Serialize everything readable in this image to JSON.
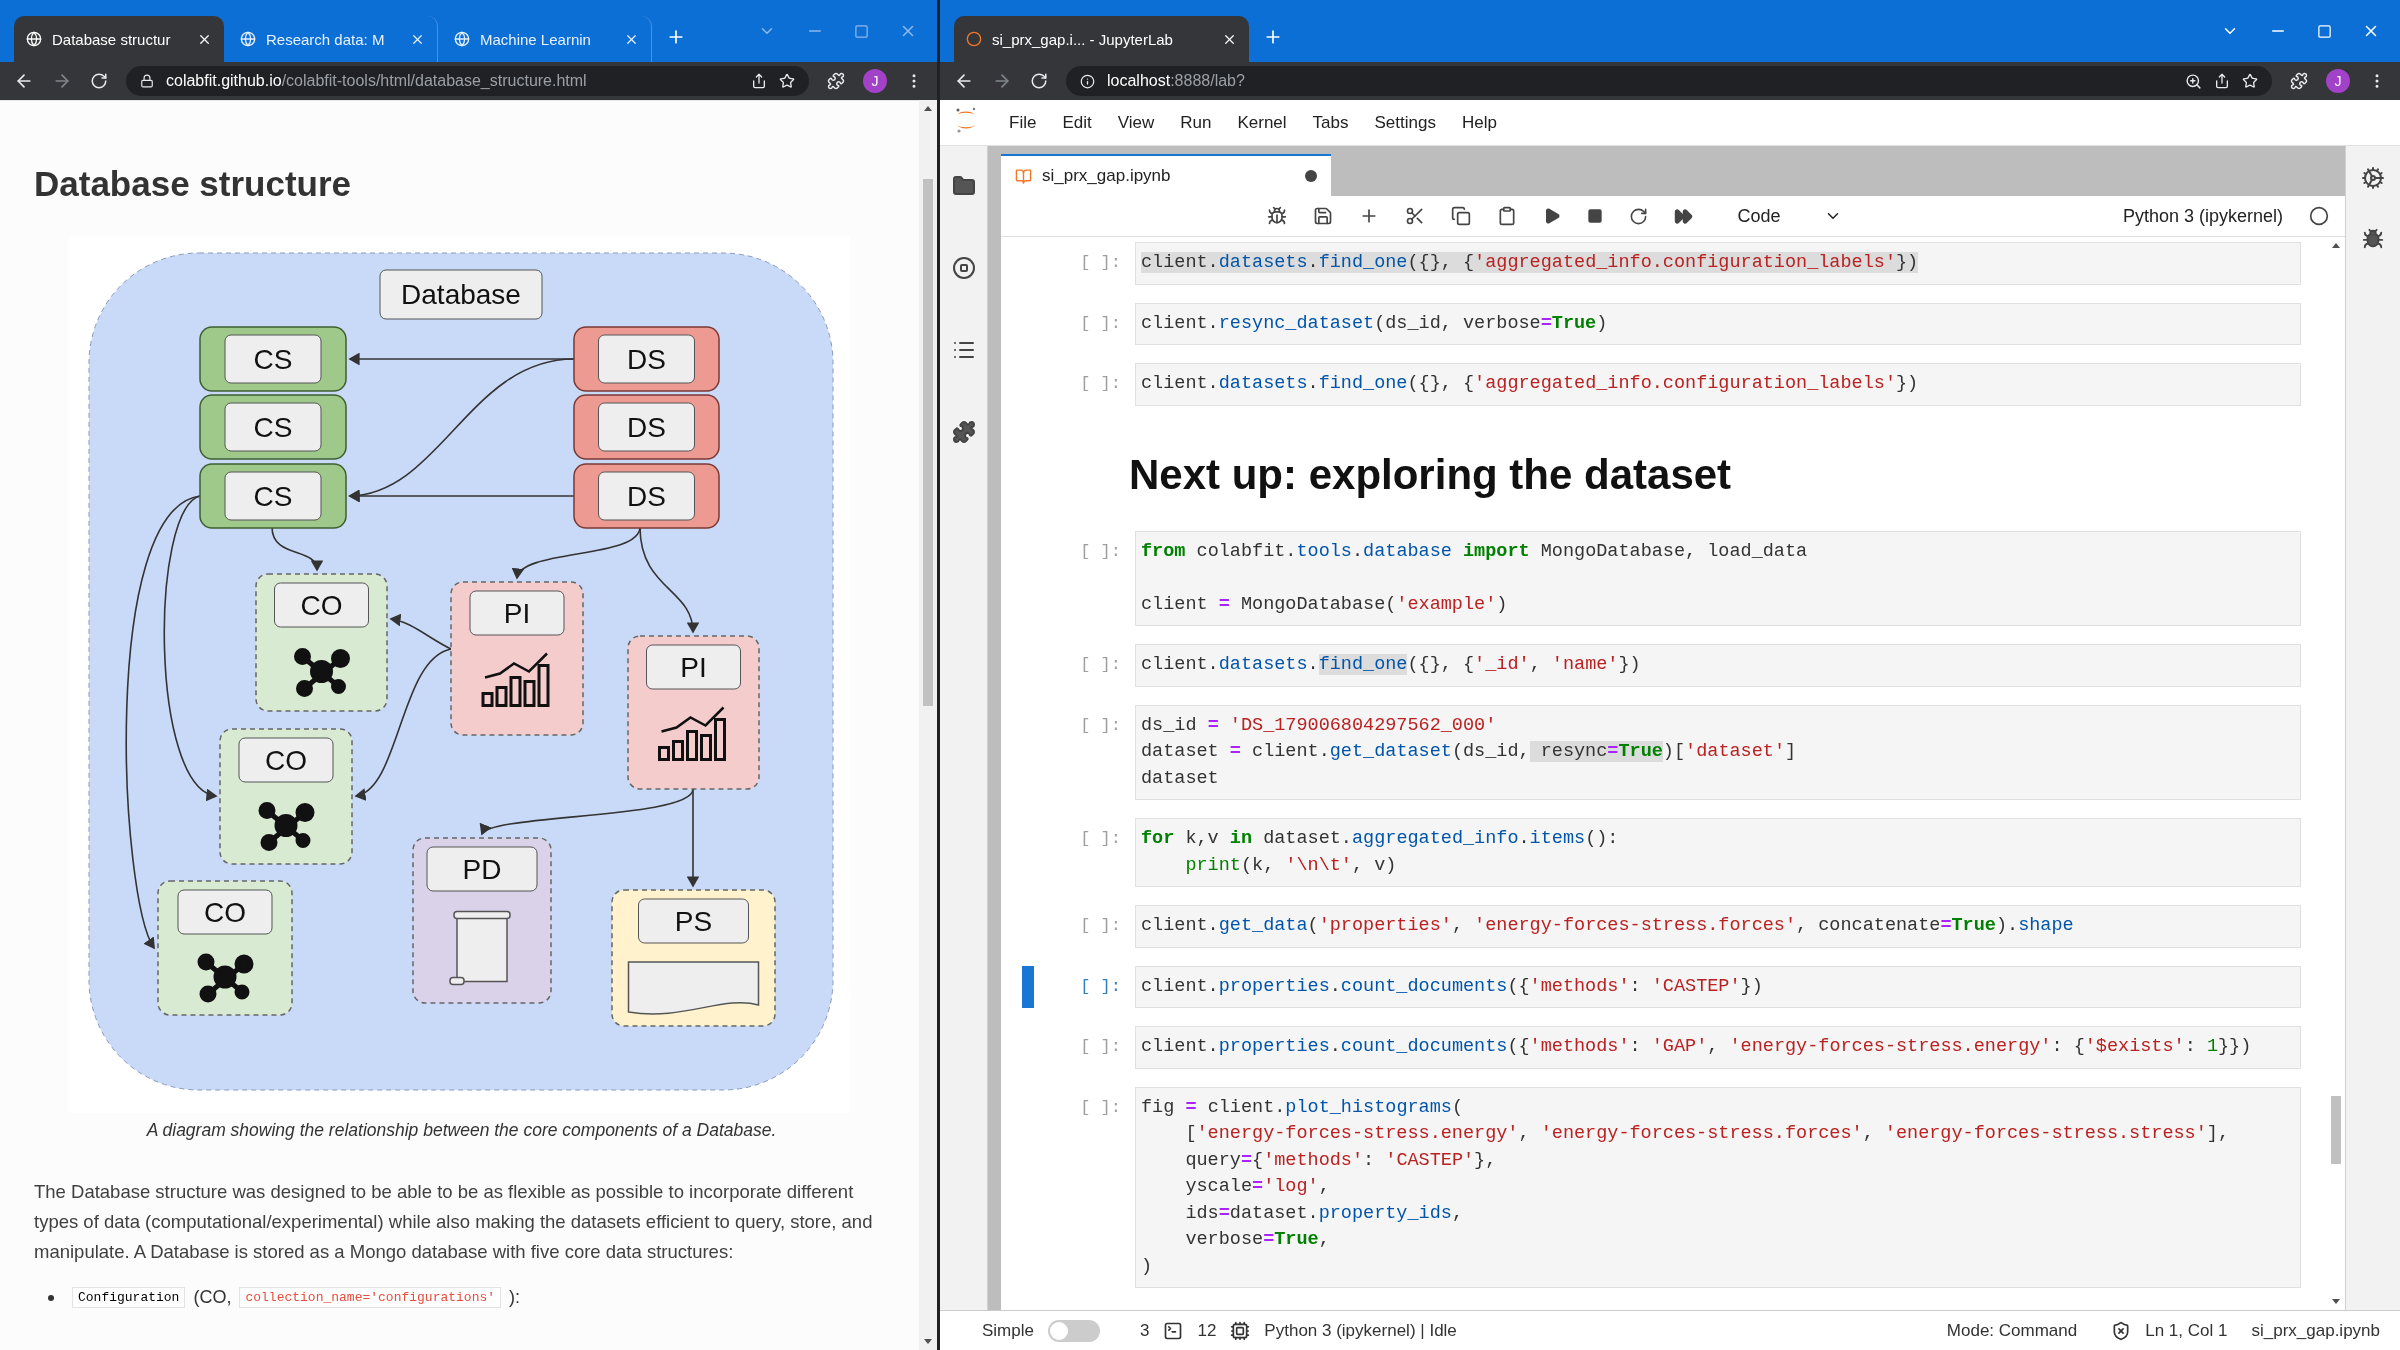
{
  "left_browser": {
    "tabs": [
      {
        "title": "Database structur",
        "selected": true
      },
      {
        "title": "Research data: M",
        "selected": false
      },
      {
        "title": "Machine Learnin",
        "selected": false
      }
    ],
    "address": {
      "host": "colabfit.github.io",
      "path": "/colabfit-tools/html/database_structure.html"
    },
    "profile": "J",
    "page": {
      "heading": "Database structure",
      "diagram": {
        "title": "Database",
        "nodes": [
          {
            "kind": "cs",
            "label": "CS"
          },
          {
            "kind": "cs",
            "label": "CS"
          },
          {
            "kind": "cs",
            "label": "CS"
          },
          {
            "kind": "ds",
            "label": "DS"
          },
          {
            "kind": "ds",
            "label": "DS"
          },
          {
            "kind": "ds",
            "label": "DS"
          },
          {
            "kind": "co",
            "label": "CO"
          },
          {
            "kind": "co",
            "label": "CO"
          },
          {
            "kind": "co",
            "label": "CO"
          },
          {
            "kind": "pi",
            "label": "PI"
          },
          {
            "kind": "pi",
            "label": "PI"
          },
          {
            "kind": "pd",
            "label": "PD"
          },
          {
            "kind": "ps",
            "label": "PS"
          }
        ]
      },
      "caption": "A diagram showing the relationship between the core components of a Database.",
      "paragraph": "The Database structure was designed to be able to be as flexible as possible to incorporate different types of data (computational/experimental) while also making the datasets efficient to query, store, and manipulate. A Database is stored as a Mongo database with five core data structures:",
      "bullet": {
        "code": "Configuration",
        "abbreviation": "(CO,",
        "collection": "collection_name='configurations'",
        "tail": "):"
      }
    }
  },
  "right_browser": {
    "tabs": [
      {
        "title": "si_prx_gap.i... - JupyterLab",
        "selected": true
      }
    ],
    "address": {
      "host": "localhost",
      "path": ":8888/lab?"
    },
    "profile": "J",
    "jupyter": {
      "menu": [
        "File",
        "Edit",
        "View",
        "Run",
        "Kernel",
        "Tabs",
        "Settings",
        "Help"
      ],
      "document_tab": {
        "title": "si_prx_gap.ipynb",
        "modified": true
      },
      "cell_type": "Code",
      "kernel": "Python 3 (ipykernel)",
      "cells": [
        {
          "kind": "code",
          "prompt": "[ ]:",
          "selected": false,
          "lines": [
            {
              "kind": "code",
              "highlighted": true,
              "segments": [
                {
                  "kind": "plain",
                  "text": "client."
                },
                {
                  "kind": "name",
                  "text": "datasets"
                },
                {
                  "kind": "plain",
                  "text": "."
                },
                {
                  "kind": "name",
                  "text": "find_one"
                },
                {
                  "kind": "plain",
                  "text": "({}, {"
                },
                {
                  "kind": "string",
                  "text": "'aggregated_info.configuration_labels'"
                },
                {
                  "kind": "plain",
                  "text": "})"
                }
              ]
            }
          ]
        },
        {
          "kind": "code",
          "prompt": "[ ]:",
          "selected": false,
          "lines": [
            {
              "kind": "code",
              "segments": [
                {
                  "kind": "plain",
                  "text": "client."
                },
                {
                  "kind": "name",
                  "text": "resync_dataset"
                },
                {
                  "kind": "plain",
                  "text": "(ds_id, verbose"
                },
                {
                  "kind": "operator",
                  "text": "="
                },
                {
                  "kind": "keyword",
                  "text": "True"
                },
                {
                  "kind": "plain",
                  "text": ")"
                }
              ]
            }
          ]
        },
        {
          "kind": "code",
          "prompt": "[ ]:",
          "selected": false,
          "lines": [
            {
              "kind": "code",
              "segments": [
                {
                  "kind": "plain",
                  "text": "client."
                },
                {
                  "kind": "name",
                  "text": "datasets"
                },
                {
                  "kind": "plain",
                  "text": "."
                },
                {
                  "kind": "name",
                  "text": "find_one"
                },
                {
                  "kind": "plain",
                  "text": "({}, {"
                },
                {
                  "kind": "string",
                  "text": "'aggregated_info.configuration_labels'"
                },
                {
                  "kind": "plain",
                  "text": "})"
                }
              ]
            }
          ]
        },
        {
          "kind": "markdown",
          "text": "Next up: exploring the dataset"
        },
        {
          "kind": "code",
          "prompt": "[ ]:",
          "selected": false,
          "lines": [
            {
              "kind": "code",
              "segments": [
                {
                  "kind": "keyword",
                  "text": "from"
                },
                {
                  "kind": "plain",
                  "text": " colabfit."
                },
                {
                  "kind": "name",
                  "text": "tools"
                },
                {
                  "kind": "plain",
                  "text": "."
                },
                {
                  "kind": "name",
                  "text": "database"
                },
                {
                  "kind": "keyword",
                  "text": " import"
                },
                {
                  "kind": "plain",
                  "text": " MongoDatabase, load_data"
                }
              ]
            },
            {
              "kind": "blank"
            },
            {
              "kind": "code",
              "segments": [
                {
                  "kind": "plain",
                  "text": "client "
                },
                {
                  "kind": "operator",
                  "text": "="
                },
                {
                  "kind": "plain",
                  "text": " MongoDatabase("
                },
                {
                  "kind": "string",
                  "text": "'example'"
                },
                {
                  "kind": "plain",
                  "text": ")"
                }
              ]
            }
          ]
        },
        {
          "kind": "code",
          "prompt": "[ ]:",
          "selected": false,
          "lines": [
            {
              "kind": "code",
              "segments": [
                {
                  "kind": "plain",
                  "text": "client."
                },
                {
                  "kind": "name",
                  "text": "datasets"
                },
                {
                  "kind": "plain",
                  "text": "."
                },
                {
                  "kind": "name",
                  "text": "find_one",
                  "highlighted": true
                },
                {
                  "kind": "plain",
                  "text": "({}, {"
                },
                {
                  "kind": "string",
                  "text": "'_id'"
                },
                {
                  "kind": "plain",
                  "text": ", "
                },
                {
                  "kind": "string",
                  "text": "'name'"
                },
                {
                  "kind": "plain",
                  "text": "})"
                }
              ]
            }
          ]
        },
        {
          "kind": "code",
          "prompt": "[ ]:",
          "selected": false,
          "lines": [
            {
              "kind": "code",
              "segments": [
                {
                  "kind": "plain",
                  "text": "ds_id "
                },
                {
                  "kind": "operator",
                  "text": "="
                },
                {
                  "kind": "string",
                  "text": " 'DS_179006804297562_000'"
                }
              ]
            },
            {
              "kind": "code",
              "segments": [
                {
                  "kind": "plain",
                  "text": "dataset "
                },
                {
                  "kind": "operator",
                  "text": "="
                },
                {
                  "kind": "plain",
                  "text": " client."
                },
                {
                  "kind": "name",
                  "text": "get_dataset"
                },
                {
                  "kind": "plain",
                  "text": "(ds_id,"
                },
                {
                  "kind": "plain",
                  "text": " resync",
                  "highlighted": true
                },
                {
                  "kind": "operator",
                  "text": "=",
                  "highlighted": true
                },
                {
                  "kind": "keyword",
                  "text": "True",
                  "highlighted": true
                },
                {
                  "kind": "plain",
                  "text": ")["
                },
                {
                  "kind": "string",
                  "text": "'dataset'"
                },
                {
                  "kind": "plain",
                  "text": "]"
                }
              ]
            },
            {
              "kind": "code",
              "segments": [
                {
                  "kind": "plain",
                  "text": "dataset"
                }
              ]
            }
          ]
        },
        {
          "kind": "code",
          "prompt": "[ ]:",
          "selected": false,
          "lines": [
            {
              "kind": "code",
              "segments": [
                {
                  "kind": "keyword",
                  "text": "for"
                },
                {
                  "kind": "plain",
                  "text": " k,v "
                },
                {
                  "kind": "keyword",
                  "text": "in"
                },
                {
                  "kind": "plain",
                  "text": " dataset."
                },
                {
                  "kind": "name",
                  "text": "aggregated_info"
                },
                {
                  "kind": "plain",
                  "text": "."
                },
                {
                  "kind": "name",
                  "text": "items"
                },
                {
                  "kind": "plain",
                  "text": "():"
                }
              ]
            },
            {
              "kind": "code",
              "segments": [
                {
                  "kind": "builtin",
                  "text": "    print"
                },
                {
                  "kind": "plain",
                  "text": "(k, "
                },
                {
                  "kind": "string",
                  "text": "'\\n\\t'"
                },
                {
                  "kind": "plain",
                  "text": ", v)"
                }
              ]
            }
          ]
        },
        {
          "kind": "code",
          "prompt": "[ ]:",
          "selected": false,
          "lines": [
            {
              "kind": "code",
              "segments": [
                {
                  "kind": "plain",
                  "text": "client."
                },
                {
                  "kind": "name",
                  "text": "get_data"
                },
                {
                  "kind": "plain",
                  "text": "("
                },
                {
                  "kind": "string",
                  "text": "'properties'"
                },
                {
                  "kind": "plain",
                  "text": ", "
                },
                {
                  "kind": "string",
                  "text": "'energy-forces-stress.forces'"
                },
                {
                  "kind": "plain",
                  "text": ", concatenate"
                },
                {
                  "kind": "operator",
                  "text": "="
                },
                {
                  "kind": "keyword",
                  "text": "True"
                },
                {
                  "kind": "plain",
                  "text": ")."
                },
                {
                  "kind": "name",
                  "text": "shape"
                }
              ]
            }
          ]
        },
        {
          "kind": "code",
          "prompt": "[ ]:",
          "selected": true,
          "lines": [
            {
              "kind": "code",
              "segments": [
                {
                  "kind": "plain",
                  "text": "client."
                },
                {
                  "kind": "name",
                  "text": "properties"
                },
                {
                  "kind": "plain",
                  "text": "."
                },
                {
                  "kind": "name",
                  "text": "count_documents"
                },
                {
                  "kind": "plain",
                  "text": "({"
                },
                {
                  "kind": "string",
                  "text": "'methods'"
                },
                {
                  "kind": "plain",
                  "text": ": "
                },
                {
                  "kind": "string",
                  "text": "'CASTEP'"
                },
                {
                  "kind": "plain",
                  "text": "})"
                }
              ]
            }
          ]
        },
        {
          "kind": "code",
          "prompt": "[ ]:",
          "selected": false,
          "lines": [
            {
              "kind": "code",
              "segments": [
                {
                  "kind": "plain",
                  "text": "client."
                },
                {
                  "kind": "name",
                  "text": "properties"
                },
                {
                  "kind": "plain",
                  "text": "."
                },
                {
                  "kind": "name",
                  "text": "count_documents"
                },
                {
                  "kind": "plain",
                  "text": "({"
                },
                {
                  "kind": "string",
                  "text": "'methods'"
                },
                {
                  "kind": "plain",
                  "text": ": "
                },
                {
                  "kind": "string",
                  "text": "'GAP'"
                },
                {
                  "kind": "plain",
                  "text": ", "
                },
                {
                  "kind": "string",
                  "text": "'energy-forces-stress.energy'"
                },
                {
                  "kind": "plain",
                  "text": ": {"
                },
                {
                  "kind": "string",
                  "text": "'$exists'"
                },
                {
                  "kind": "plain",
                  "text": ": "
                },
                {
                  "kind": "number",
                  "text": "1"
                },
                {
                  "kind": "plain",
                  "text": "}})"
                }
              ]
            }
          ]
        },
        {
          "kind": "code",
          "prompt": "[ ]:",
          "selected": false,
          "lines": [
            {
              "kind": "code",
              "segments": [
                {
                  "kind": "plain",
                  "text": "fig "
                },
                {
                  "kind": "operator",
                  "text": "="
                },
                {
                  "kind": "plain",
                  "text": " client."
                },
                {
                  "kind": "name",
                  "text": "plot_histograms"
                },
                {
                  "kind": "plain",
                  "text": "("
                }
              ]
            },
            {
              "kind": "code",
              "segments": [
                {
                  "kind": "plain",
                  "text": "    ["
                },
                {
                  "kind": "string",
                  "text": "'energy-forces-stress.energy'"
                },
                {
                  "kind": "plain",
                  "text": ", "
                },
                {
                  "kind": "string",
                  "text": "'energy-forces-stress.forces'"
                },
                {
                  "kind": "plain",
                  "text": ", "
                },
                {
                  "kind": "string",
                  "text": "'energy-forces-stress.stress'"
                },
                {
                  "kind": "plain",
                  "text": "],"
                }
              ]
            },
            {
              "kind": "code",
              "segments": [
                {
                  "kind": "plain",
                  "text": "    query"
                },
                {
                  "kind": "operator",
                  "text": "="
                },
                {
                  "kind": "plain",
                  "text": "{"
                },
                {
                  "kind": "string",
                  "text": "'methods'"
                },
                {
                  "kind": "plain",
                  "text": ": "
                },
                {
                  "kind": "string",
                  "text": "'CASTEP'"
                },
                {
                  "kind": "plain",
                  "text": "},"
                }
              ]
            },
            {
              "kind": "code",
              "segments": [
                {
                  "kind": "plain",
                  "text": "    yscale"
                },
                {
                  "kind": "operator",
                  "text": "="
                },
                {
                  "kind": "string",
                  "text": "'log'"
                },
                {
                  "kind": "plain",
                  "text": ","
                }
              ]
            },
            {
              "kind": "code",
              "segments": [
                {
                  "kind": "plain",
                  "text": "    ids"
                },
                {
                  "kind": "operator",
                  "text": "="
                },
                {
                  "kind": "plain",
                  "text": "dataset."
                },
                {
                  "kind": "name",
                  "text": "property_ids"
                },
                {
                  "kind": "plain",
                  "text": ","
                }
              ]
            },
            {
              "kind": "code",
              "segments": [
                {
                  "kind": "plain",
                  "text": "    verbose"
                },
                {
                  "kind": "operator",
                  "text": "="
                },
                {
                  "kind": "keyword",
                  "text": "True"
                },
                {
                  "kind": "plain",
                  "text": ","
                }
              ]
            },
            {
              "kind": "code",
              "segments": [
                {
                  "kind": "plain",
                  "text": ")"
                }
              ]
            }
          ]
        }
      ],
      "status_bar": {
        "mode_label": "Simple",
        "simple_on": false,
        "terminals": "3",
        "kernels": "12",
        "kernel_status": "Python 3 (ipykernel) | Idle",
        "mode": "Mode: Command",
        "position": "Ln 1, Col 1",
        "file": "si_prx_gap.ipynb"
      }
    }
  }
}
